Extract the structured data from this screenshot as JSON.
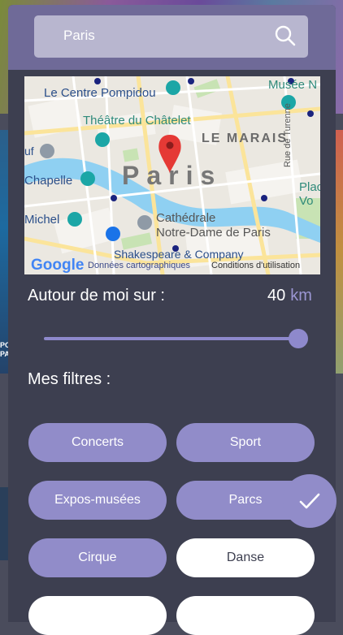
{
  "search": {
    "value": "Paris"
  },
  "map": {
    "labels": {
      "centre_pompidou": "Le Centre Pompidou",
      "musee": "Musée N",
      "theatre": "Théâtre du Châtelet",
      "marais": "LE MARAIS",
      "turenne": "Rue de Turenne",
      "city": "Paris",
      "ouf": "uf",
      "chapelle": "Chapelle",
      "michel": "Michel",
      "cathedrale_1": "Cathédrale",
      "cathedrale_2": "Notre-Dame de Paris",
      "place_1": "Plac",
      "place_2": "Vo",
      "shakespeare": "Shakespeare & Company",
      "google": "Google",
      "map_data": "Données cartographiques",
      "terms": "Conditions d'utilisation"
    }
  },
  "radius": {
    "label": "Autour de moi sur :",
    "value": "40",
    "unit": "km",
    "level": 1.0
  },
  "filters": {
    "title": "Mes filtres :",
    "chips": [
      {
        "label": "Concerts",
        "active": true
      },
      {
        "label": "Sport",
        "active": true
      },
      {
        "label": "Expos-musées",
        "active": true
      },
      {
        "label": "Parcs",
        "active": true
      },
      {
        "label": "Cirque",
        "active": true
      },
      {
        "label": "Danse",
        "active": false
      }
    ]
  },
  "background": {
    "left_text": "PO PA"
  },
  "colors": {
    "sheet": "#3d3f50",
    "header": "#6f6a98",
    "accent": "#918cc9",
    "unit": "#9b96d3"
  },
  "icons": {
    "search": "search-icon",
    "confirm": "check-icon",
    "pin": "map-pin-icon"
  }
}
